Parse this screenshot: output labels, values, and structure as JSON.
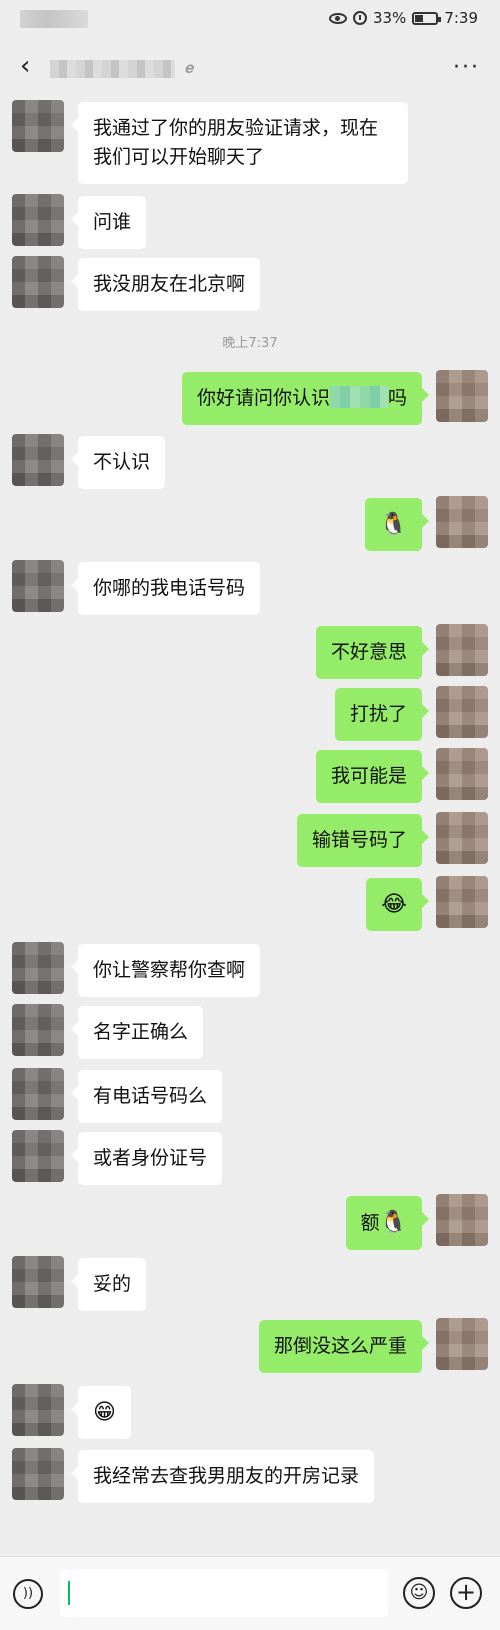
{
  "status_bar": {
    "battery": "33%",
    "time": "7:39"
  },
  "header": {
    "more": "···"
  },
  "chat": {
    "timestamp": "晚上7:37",
    "messages": [
      {
        "from": "them",
        "text": "我通过了你的朋友验证请求，现在我们可以开始聊天了"
      },
      {
        "from": "them",
        "text": "问谁"
      },
      {
        "from": "them",
        "text": "我没朋友在北京啊"
      },
      {
        "from": "me",
        "text_before": "你好请问你认识",
        "text_after": "吗"
      },
      {
        "from": "them",
        "text": "不认识"
      },
      {
        "from": "me",
        "emoji": "🐧"
      },
      {
        "from": "them",
        "text": "你哪的我电话号码"
      },
      {
        "from": "me",
        "text": "不好意思"
      },
      {
        "from": "me",
        "text": "打扰了"
      },
      {
        "from": "me",
        "text": "我可能是"
      },
      {
        "from": "me",
        "text": "输错号码了"
      },
      {
        "from": "me",
        "emoji": "😂"
      },
      {
        "from": "them",
        "text": "你让警察帮你查啊"
      },
      {
        "from": "them",
        "text": "名字正确么"
      },
      {
        "from": "them",
        "text": "有电话号码么"
      },
      {
        "from": "them",
        "text": "或者身份证号"
      },
      {
        "from": "me",
        "text": "额",
        "emoji": "🐧"
      },
      {
        "from": "them",
        "text": "妥的"
      },
      {
        "from": "me",
        "text": "那倒没这么严重"
      },
      {
        "from": "them",
        "emoji": "😁"
      },
      {
        "from": "them",
        "text": "我经常去查我男朋友的开房记录"
      }
    ]
  },
  "input_bar": {
    "voice_icon": "))",
    "emoji_icon": "☺",
    "plus_icon": "+"
  },
  "colors": {
    "outgoing_bubble": "#95ec69",
    "incoming_bubble": "#ffffff",
    "background": "#ededed"
  }
}
